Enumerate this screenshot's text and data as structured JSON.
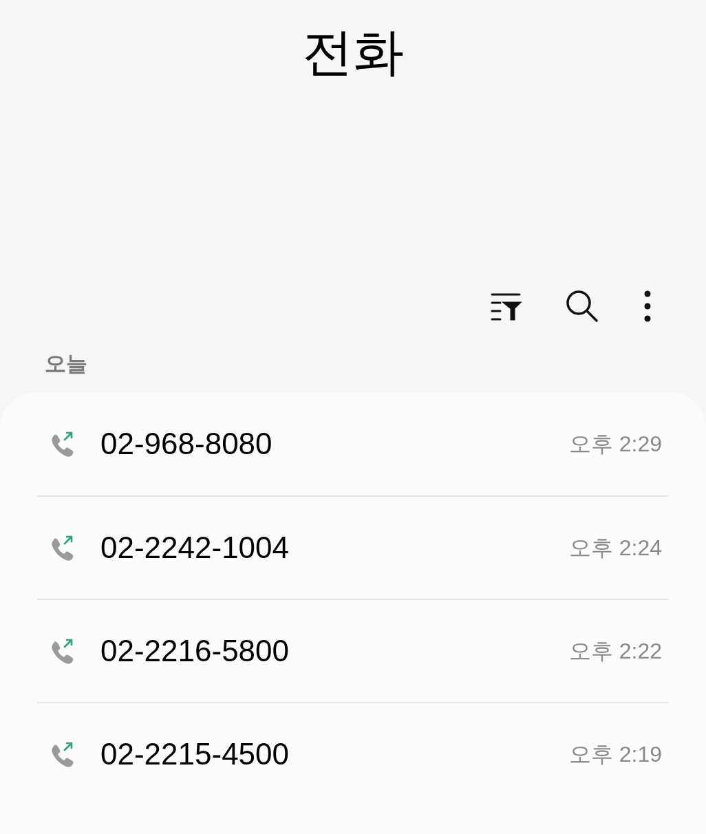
{
  "title": "전화",
  "section_label": "오늘",
  "calls": [
    {
      "kind": "outgoing",
      "number": "02-968-8080",
      "time": "오후 2:29"
    },
    {
      "kind": "outgoing",
      "number": "02-2242-1004",
      "time": "오후 2:24"
    },
    {
      "kind": "outgoing",
      "number": "02-2216-5800",
      "time": "오후 2:22"
    },
    {
      "kind": "outgoing",
      "number": "02-2215-4500",
      "time": "오후 2:19"
    }
  ]
}
